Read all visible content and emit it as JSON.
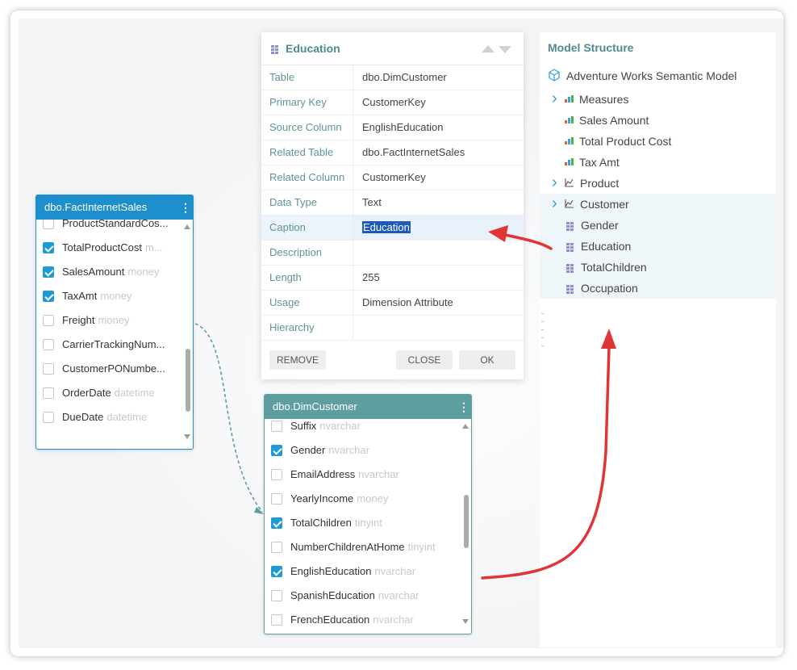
{
  "fact_table": {
    "title": "dbo.FactInternetSales",
    "fields": [
      {
        "name": "ProductStandardCos...",
        "type": "",
        "checked": false
      },
      {
        "name": "TotalProductCost",
        "type": "m...",
        "checked": true
      },
      {
        "name": "SalesAmount",
        "type": "money",
        "checked": true
      },
      {
        "name": "TaxAmt",
        "type": "money",
        "checked": true
      },
      {
        "name": "Freight",
        "type": "money",
        "checked": false
      },
      {
        "name": "CarrierTrackingNum...",
        "type": "",
        "checked": false
      },
      {
        "name": "CustomerPONumbe...",
        "type": "",
        "checked": false
      },
      {
        "name": "OrderDate",
        "type": "datetime",
        "checked": false
      },
      {
        "name": "DueDate",
        "type": "datetime",
        "checked": false
      }
    ]
  },
  "dim_table": {
    "title": "dbo.DimCustomer",
    "fields": [
      {
        "name": "Suffix",
        "type": "nvarchar",
        "checked": false
      },
      {
        "name": "Gender",
        "type": "nvarchar",
        "checked": true
      },
      {
        "name": "EmailAddress",
        "type": "nvarchar",
        "checked": false
      },
      {
        "name": "YearlyIncome",
        "type": "money",
        "checked": false
      },
      {
        "name": "TotalChildren",
        "type": "tinyint",
        "checked": true
      },
      {
        "name": "NumberChildrenAtHome",
        "type": "tinyint",
        "checked": false
      },
      {
        "name": "EnglishEducation",
        "type": "nvarchar",
        "checked": true
      },
      {
        "name": "SpanishEducation",
        "type": "nvarchar",
        "checked": false
      },
      {
        "name": "FrenchEducation",
        "type": "nvarchar",
        "checked": false
      }
    ]
  },
  "dialog": {
    "title": "Education",
    "properties": [
      {
        "label": "Table",
        "value": "dbo.DimCustomer"
      },
      {
        "label": "Primary Key",
        "value": "CustomerKey"
      },
      {
        "label": "Source Column",
        "value": "EnglishEducation"
      },
      {
        "label": "Related Table",
        "value": "dbo.FactInternetSales"
      },
      {
        "label": "Related Column",
        "value": "CustomerKey"
      },
      {
        "label": "Data Type",
        "value": "Text"
      },
      {
        "label": "Caption",
        "value": "Education"
      },
      {
        "label": "Description",
        "value": ""
      },
      {
        "label": "Length",
        "value": "255"
      },
      {
        "label": "Usage",
        "value": "Dimension Attribute"
      },
      {
        "label": "Hierarchy",
        "value": ""
      }
    ],
    "remove_label": "REMOVE",
    "close_label": "CLOSE",
    "ok_label": "OK"
  },
  "model": {
    "title": "Model Structure",
    "root": "Adventure Works Semantic Model",
    "items": [
      {
        "label": "Measures",
        "icon": "bar-chart-icon",
        "expandable": true,
        "level": 0
      },
      {
        "label": "Sales Amount",
        "icon": "bar-chart-icon",
        "expandable": false,
        "level": 1
      },
      {
        "label": "Total Product Cost",
        "icon": "bar-chart-icon",
        "expandable": false,
        "level": 1
      },
      {
        "label": "Tax Amt",
        "icon": "bar-chart-icon",
        "expandable": false,
        "level": 1
      },
      {
        "label": "Product",
        "icon": "hierarchy-icon",
        "expandable": true,
        "level": 0
      },
      {
        "label": "Customer",
        "icon": "hierarchy-icon",
        "expandable": true,
        "level": 0
      },
      {
        "label": "Gender",
        "icon": "grid-icon",
        "expandable": false,
        "level": 1
      },
      {
        "label": "Education",
        "icon": "grid-icon",
        "expandable": false,
        "level": 1
      },
      {
        "label": "TotalChildren",
        "icon": "grid-icon",
        "expandable": false,
        "level": 1
      },
      {
        "label": "Occupation",
        "icon": "grid-icon",
        "expandable": false,
        "level": 1
      }
    ]
  },
  "colors": {
    "fact_header": "#1e8fcc",
    "dim_header": "#5f9e9f",
    "accent_teal": "#4f8a8f",
    "checkbox_blue": "#1e9bd7",
    "arrow_red": "#e03535"
  }
}
